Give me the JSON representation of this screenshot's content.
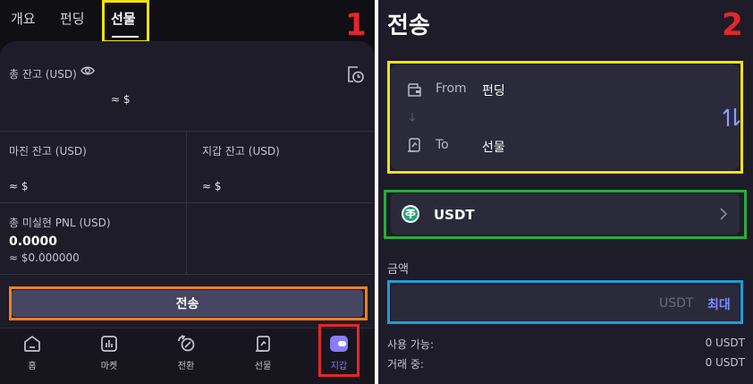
{
  "left_panel": {
    "step_number": "1",
    "tabs": [
      {
        "label": "개요"
      },
      {
        "label": "펀딩"
      },
      {
        "label": "선물",
        "active": true
      }
    ],
    "balance": {
      "total_label": "총 잔고 (USD)",
      "total_value": "≈ $"
    },
    "margin_balance": {
      "label": "마진 잔고 (USD)",
      "value": "≈ $"
    },
    "wallet_balance": {
      "label": "지갑 잔고 (USD)",
      "value": "≈ $"
    },
    "unrealized_pnl": {
      "label": "총 미실현 PNL (USD)",
      "value": "0.0000",
      "approx": "≈ $0.000000"
    },
    "transfer_button": "전송",
    "bottom_nav": [
      {
        "label": "홈",
        "icon": "home-icon"
      },
      {
        "label": "마켓",
        "icon": "market-chart-icon"
      },
      {
        "label": "전환",
        "icon": "convert-icon"
      },
      {
        "label": "선물",
        "icon": "futures-icon"
      },
      {
        "label": "지갑",
        "icon": "wallet-icon",
        "active": true
      }
    ]
  },
  "right_panel": {
    "step_number": "2",
    "title": "전송",
    "from_label": "From",
    "from_value": "펀딩",
    "to_label": "To",
    "to_value": "선물",
    "coin": "USDT",
    "amount_label": "금액",
    "amount_unit": "USDT",
    "max_button": "최대",
    "available_label": "사용 가능:",
    "available_value": "0 USDT",
    "in_order_label": "거래 중:",
    "in_order_value": "0 USDT"
  },
  "colors": {
    "highlight_yellow": "#f2e20e",
    "highlight_orange": "#f07f22",
    "highlight_red": "#e3262a",
    "highlight_green": "#26ad3c",
    "highlight_blue": "#1f9bd9",
    "accent": "#8a7cff"
  }
}
